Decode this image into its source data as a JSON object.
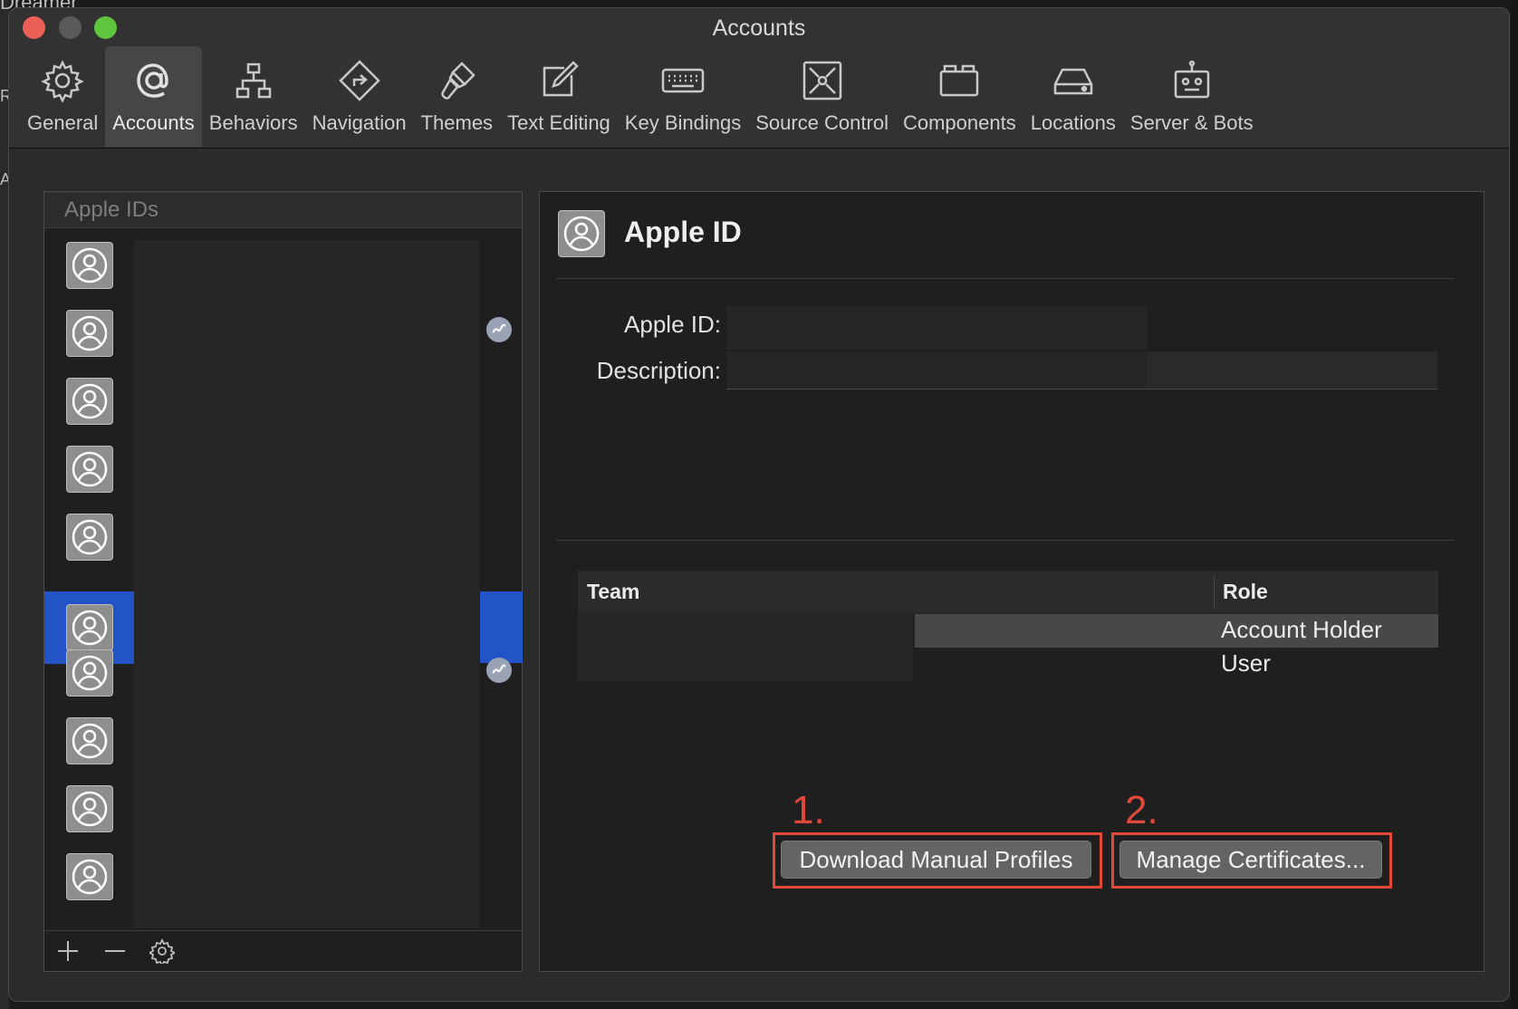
{
  "background": {
    "top_text": "Dreamer",
    "side_char_1": "R",
    "side_char_2": "A"
  },
  "window": {
    "title": "Accounts"
  },
  "toolbar": {
    "items": [
      {
        "label": "General",
        "icon": "gear-icon"
      },
      {
        "label": "Accounts",
        "icon": "at-sign-icon"
      },
      {
        "label": "Behaviors",
        "icon": "hierarchy-icon"
      },
      {
        "label": "Navigation",
        "icon": "navigation-sign-icon"
      },
      {
        "label": "Themes",
        "icon": "paintbrush-icon"
      },
      {
        "label": "Text Editing",
        "icon": "edit-icon"
      },
      {
        "label": "Key Bindings",
        "icon": "keyboard-icon"
      },
      {
        "label": "Source Control",
        "icon": "source-control-icon"
      },
      {
        "label": "Components",
        "icon": "box-icon"
      },
      {
        "label": "Locations",
        "icon": "disk-icon"
      },
      {
        "label": "Server & Bots",
        "icon": "robot-icon"
      }
    ],
    "active": "Accounts"
  },
  "apple_ids": {
    "header": "Apple IDs",
    "account_count": 10,
    "selected_index": 5
  },
  "detail": {
    "title": "Apple ID",
    "apple_id_label": "Apple ID:",
    "description_label": "Description:",
    "team_table": {
      "columns": [
        "Team",
        "Role"
      ],
      "rows": [
        {
          "team": "",
          "role": "Account Holder"
        },
        {
          "team": "",
          "role": "User"
        }
      ]
    },
    "annotations": {
      "step1": "1.",
      "step2": "2."
    },
    "buttons": {
      "download_profiles": "Download Manual Profiles",
      "manage_certificates": "Manage Certificates..."
    }
  },
  "colors": {
    "selection": "#2254c7",
    "annotation_red": "#e0483a"
  }
}
